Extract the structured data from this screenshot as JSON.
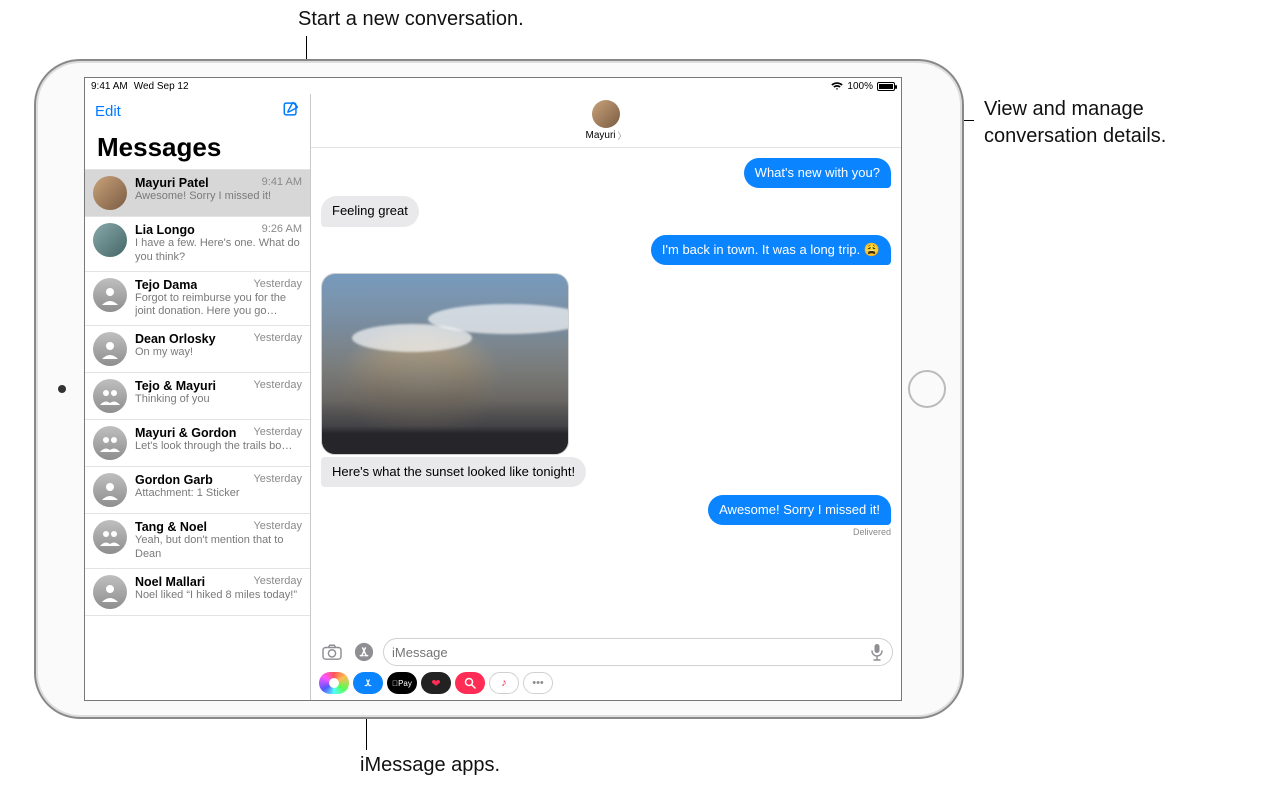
{
  "callouts": {
    "compose": "Start a new conversation.",
    "details": "View and manage conversation details.",
    "apps": "iMessage apps."
  },
  "status_bar": {
    "time": "9:41 AM",
    "date": "Wed Sep 12",
    "battery_percent": "100%"
  },
  "sidebar": {
    "edit_label": "Edit",
    "title": "Messages",
    "conversations": [
      {
        "name": "Mayuri Patel",
        "time": "9:41 AM",
        "preview": "Awesome! Sorry I missed it!",
        "selected": true,
        "avatar": "photo"
      },
      {
        "name": "Lia Longo",
        "time": "9:26 AM",
        "preview": "I have a few. Here's one. What do you think?",
        "avatar": "photo2"
      },
      {
        "name": "Tejo Dama",
        "time": "Yesterday",
        "preview": "Forgot to reimburse you for the joint donation. Here you go…"
      },
      {
        "name": "Dean Orlosky",
        "time": "Yesterday",
        "preview": "On my way!"
      },
      {
        "name": "Tejo & Mayuri",
        "time": "Yesterday",
        "preview": "Thinking of you",
        "group": true
      },
      {
        "name": "Mayuri & Gordon",
        "time": "Yesterday",
        "preview": "Let's look through the trails bo…",
        "group": true
      },
      {
        "name": "Gordon Garb",
        "time": "Yesterday",
        "preview": "Attachment: 1 Sticker"
      },
      {
        "name": "Tang & Noel",
        "time": "Yesterday",
        "preview": "Yeah, but don't mention that to Dean",
        "group": true
      },
      {
        "name": "Noel Mallari",
        "time": "Yesterday",
        "preview": "Noel liked “I hiked 8 miles today!”"
      }
    ]
  },
  "conversation": {
    "header_name": "Mayuri",
    "messages": {
      "m1_out": "What's new with you?",
      "m2_in": "Feeling great",
      "m3_out": "I'm back in town. It was a long trip. 😩",
      "photo_caption": "Here's what the sunset looked like tonight!",
      "m5_out": "Awesome! Sorry I missed it!",
      "delivered": "Delivered"
    }
  },
  "compose": {
    "placeholder": "iMessage",
    "applepay_label": "Pay"
  }
}
